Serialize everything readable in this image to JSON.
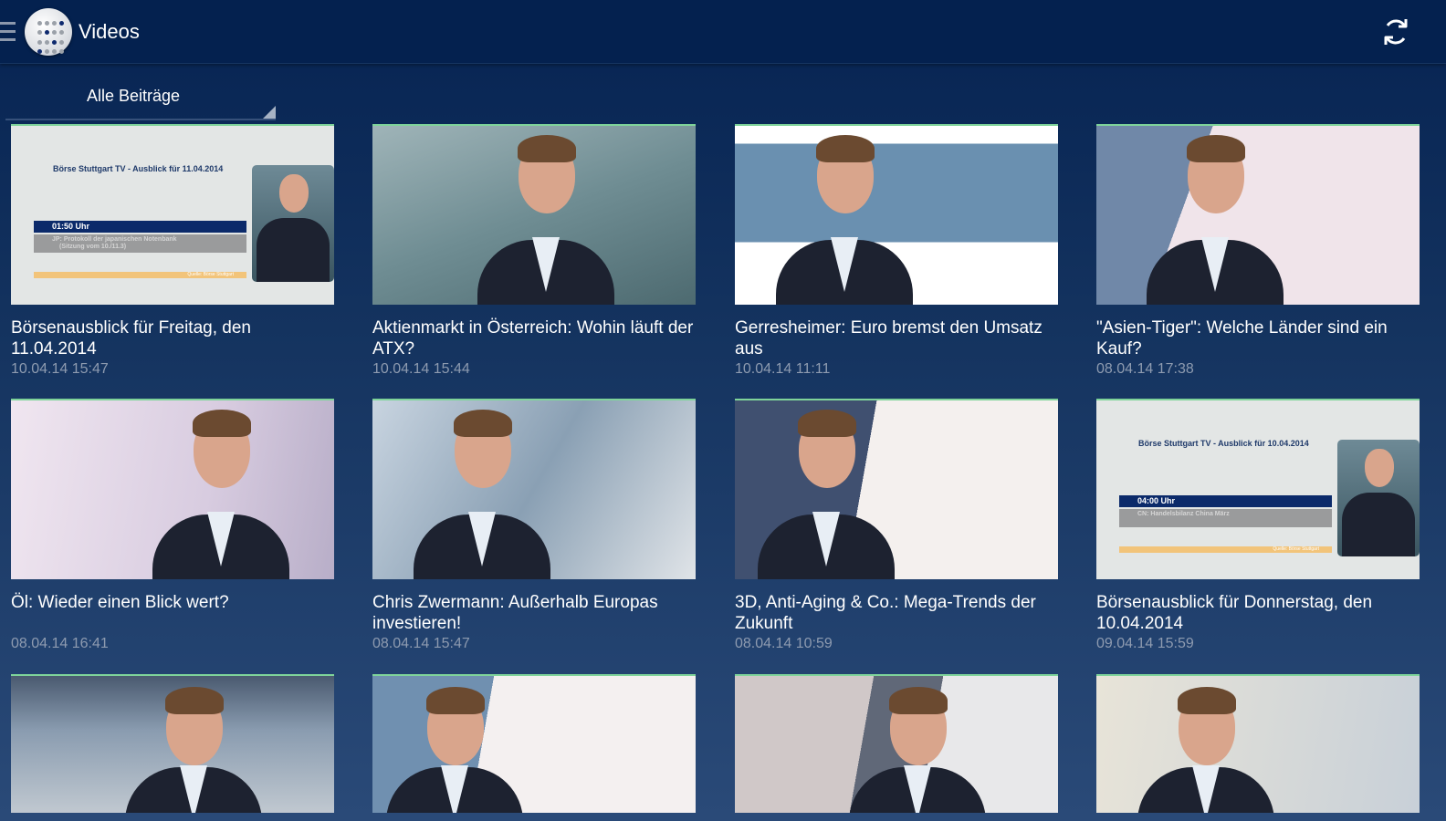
{
  "header": {
    "title": "Videos",
    "menu_icon": "hamburger-icon",
    "logo_icon": "app-logo-dots",
    "refresh_icon": "refresh-icon"
  },
  "filter": {
    "selected": "Alle Beiträge"
  },
  "videos": [
    {
      "title": "Börsenausblick für Freitag, den 11.04.2014",
      "date": "10.04.14 15:47",
      "slide": {
        "heading": "Börse Stuttgart TV - Ausblick für 11.04.2014",
        "time": "01:50 Uhr",
        "line1": "JP: Protokoll der japanischen Notenbank",
        "line2": "(Sitzung vom 10./11.3)",
        "source": "Quelle: Börse Stuttgart"
      }
    },
    {
      "title": "Aktienmarkt in Österreich: Wohin läuft der ATX?",
      "date": "10.04.14 15:44"
    },
    {
      "title": "Gerresheimer: Euro bremst den Umsatz aus",
      "date": "10.04.14 11:11"
    },
    {
      "title": "\"Asien-Tiger\": Welche Länder sind ein Kauf?",
      "date": "08.04.14 17:38"
    },
    {
      "title": "Öl: Wieder einen Blick wert?",
      "date": "08.04.14 16:41"
    },
    {
      "title": "Chris Zwermann: Außerhalb Europas investieren!",
      "date": "08.04.14 15:47"
    },
    {
      "title": "3D, Anti-Aging & Co.: Mega-Trends der Zukunft",
      "date": "08.04.14 10:59"
    },
    {
      "title": "Börsenausblick für Donnerstag, den 10.04.2014",
      "date": "09.04.14 15:59",
      "slide": {
        "heading": "Börse Stuttgart TV - Ausblick für 10.04.2014",
        "time": "04:00 Uhr",
        "line1": "CN: Handelsbilanz China März",
        "line2": "",
        "source": "Quelle: Börse Stuttgart"
      }
    },
    {
      "title": "",
      "date": ""
    },
    {
      "title": "",
      "date": ""
    },
    {
      "title": "",
      "date": ""
    },
    {
      "title": "",
      "date": ""
    }
  ],
  "colors": {
    "header": "#04214f",
    "accent": "#7fd49a",
    "date": "#8e9bb0"
  }
}
